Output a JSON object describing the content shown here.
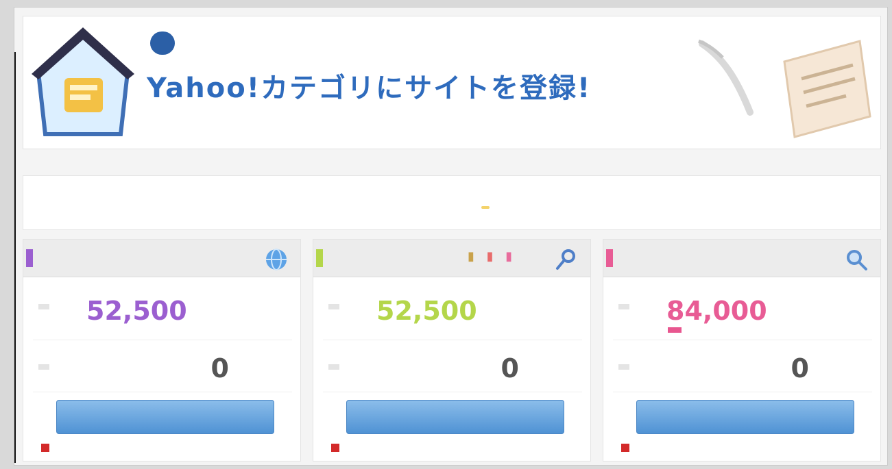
{
  "banner": {
    "pill": "",
    "title": "Yahoo!カテゴリにサイトを登録!",
    "description": ""
  },
  "note_label": "",
  "notice": {
    "text": "",
    "link": "",
    "badge": ""
  },
  "plans": [
    {
      "name": "",
      "accent": "#9b5fd0",
      "price": "52,500",
      "price_unit": "",
      "price_label": "",
      "initial_label": "",
      "initial_value": "0",
      "initial_unit": "",
      "button_label": "",
      "detail_link": "",
      "icon": "globe-icon"
    },
    {
      "name": "",
      "accent": "#b4d64a",
      "price": "52,500",
      "price_unit": "",
      "price_label": "",
      "initial_label": "",
      "initial_value": "0",
      "initial_unit": "",
      "button_label": "",
      "detail_link": "",
      "icon": "search-icon"
    },
    {
      "name": "",
      "accent": "#e85c95",
      "price": "84,000",
      "price_unit": "",
      "price_label": "",
      "sale_badge": "",
      "initial_label": "",
      "initial_value": "0",
      "initial_unit": "",
      "button_label": "",
      "detail_link": "",
      "icon": "magnifier-icon"
    }
  ],
  "colors": {
    "brand_blue": "#2e6bbd",
    "button_blue": "#5a9be0",
    "link_blue": "#3b63c4"
  }
}
